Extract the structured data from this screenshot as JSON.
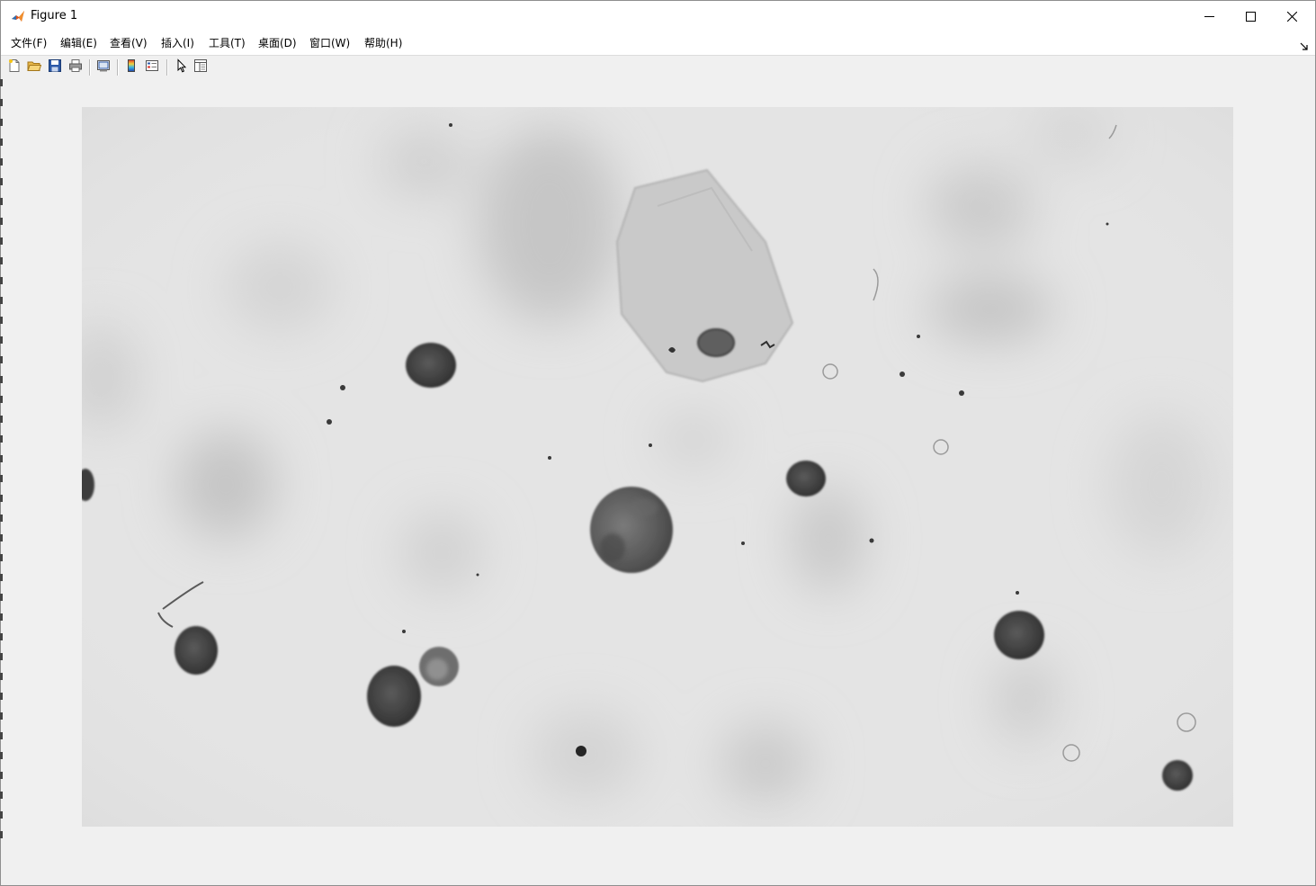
{
  "window": {
    "title": "Figure 1",
    "app_icon": "matlab-icon",
    "controls": [
      "minimize-icon",
      "maximize-icon",
      "close-icon"
    ]
  },
  "menubar": {
    "items": [
      {
        "id": "file",
        "label": "文件(F)"
      },
      {
        "id": "edit",
        "label": "编辑(E)"
      },
      {
        "id": "view",
        "label": "查看(V)"
      },
      {
        "id": "insert",
        "label": "插入(I)"
      },
      {
        "id": "tools",
        "label": "工具(T)"
      },
      {
        "id": "desktop",
        "label": "桌面(D)"
      },
      {
        "id": "window",
        "label": "窗口(W)"
      },
      {
        "id": "help",
        "label": "帮助(H)"
      }
    ],
    "dock_icon": "dock-arrow-icon"
  },
  "toolbar": {
    "buttons": [
      "new-figure-icon",
      "open-file-icon",
      "save-icon",
      "print-icon",
      "link-plot-icon",
      "insert-colorbar-icon",
      "insert-legend-icon",
      "edit-plot-icon",
      "property-inspector-icon"
    ]
  },
  "figure": {
    "content": "grayscale-microscopy-image",
    "colors": {
      "background": "#e3e3e3",
      "cell_dark": "#3a3a3a",
      "cell_mid": "#6e6e6e"
    }
  }
}
